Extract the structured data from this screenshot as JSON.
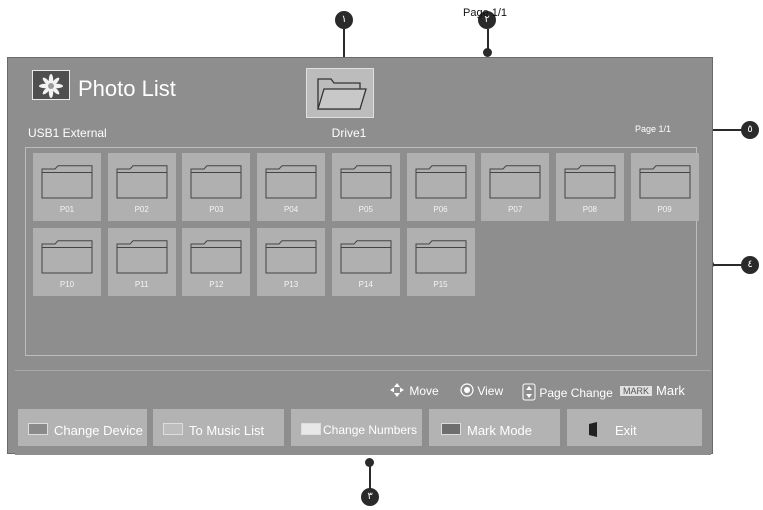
{
  "callouts": {
    "c1": "١",
    "c2": "٢",
    "c3": "٣",
    "c4": "٤",
    "c5": "٥"
  },
  "header": {
    "title": "Photo List",
    "device_label": "USB1 External",
    "drive_label": "Drive1",
    "page_indicator_top": "Page 1/1",
    "page_indicator_right": "Page 1/1"
  },
  "folders": [
    "P01",
    "P02",
    "P03",
    "P04",
    "P05",
    "P06",
    "P07",
    "P08",
    "P09",
    "P10",
    "P11",
    "P12",
    "P13",
    "P14",
    "P15"
  ],
  "hints": {
    "move": "Move",
    "view": "View",
    "page_change": "Page Change",
    "mark_key": "MARK",
    "mark": "Mark"
  },
  "buttons": {
    "change_device": "Change Device",
    "to_music_list": "To Music List",
    "change_numbers": "Change Numbers",
    "mark_mode": "Mark Mode",
    "exit": "Exit"
  },
  "colors": {
    "screen_bg": "#8e8e8e",
    "tile_bg": "#b0b0b0",
    "button_bg": "#b3b3b3",
    "callout": "#2a2a2a"
  }
}
